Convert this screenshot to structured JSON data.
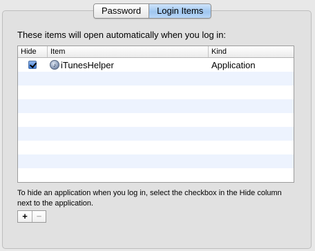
{
  "tabs": [
    {
      "label": "Password",
      "active": false
    },
    {
      "label": "Login Items",
      "active": true
    }
  ],
  "intro_text": "These items will open automatically when you log in:",
  "table": {
    "columns": {
      "hide": "Hide",
      "item": "Item",
      "kind": "Kind"
    },
    "rows": [
      {
        "hide": true,
        "icon": "itunes-helper-icon",
        "item": "iTunesHelper",
        "kind": "Application"
      }
    ]
  },
  "help_text": "To hide an application when you log in, select the checkbox in the Hide column next to the application.",
  "buttons": {
    "add": "+",
    "remove": "−"
  },
  "colors": {
    "selected_tab": "#a9cdf2",
    "alt_row": "#edf3fe"
  }
}
